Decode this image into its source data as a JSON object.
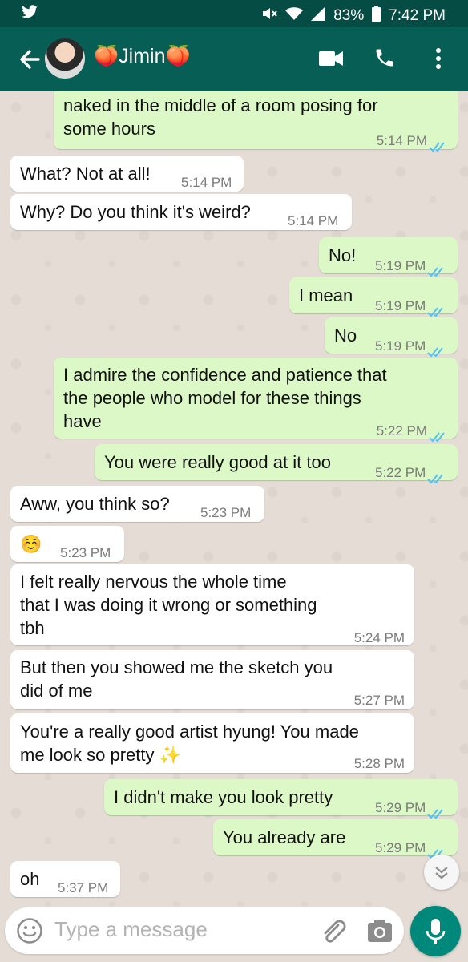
{
  "status_bar": {
    "battery": "83%",
    "time": "7:42 PM"
  },
  "header": {
    "contact_emoji_left": "🍑",
    "contact_name": "Jimin",
    "contact_emoji_right": "🍑"
  },
  "messages": [
    {
      "dir": "out",
      "text": "Some people think it's weird to sit bare naked in the middle of a room posing for some hours",
      "visible_text": "naked in the middle of a room posing for\nsome hours",
      "time": "5:14 PM"
    },
    {
      "dir": "in",
      "text": "What? Not at all!",
      "time": "5:14 PM"
    },
    {
      "dir": "in",
      "text": "Why? Do you think it's weird?",
      "time": "5:14 PM"
    },
    {
      "dir": "out",
      "text": "No!",
      "time": "5:19 PM"
    },
    {
      "dir": "out",
      "text": "I mean",
      "time": "5:19 PM"
    },
    {
      "dir": "out",
      "text": "No",
      "time": "5:19 PM"
    },
    {
      "dir": "out",
      "text": "I admire the confidence and patience that\nthe people who model for these things\nhave",
      "time": "5:22 PM"
    },
    {
      "dir": "out",
      "text": "You were really good at it too",
      "time": "5:22 PM"
    },
    {
      "dir": "in",
      "text": "Aww, you think so?",
      "time": "5:23 PM"
    },
    {
      "dir": "in",
      "text": "☺️",
      "time": "5:23 PM"
    },
    {
      "dir": "in",
      "text": "I felt really nervous the whole time\nthat I was doing it wrong or something\ntbh",
      "time": "5:24 PM"
    },
    {
      "dir": "in",
      "text": "But then you showed me the sketch you\ndid of me",
      "time": "5:27 PM"
    },
    {
      "dir": "in",
      "text": "You're a really good artist hyung! You made\nme look so pretty ✨",
      "time": "5:28 PM"
    },
    {
      "dir": "out",
      "text": "I didn't make you look pretty",
      "time": "5:29 PM"
    },
    {
      "dir": "out",
      "text": "You already are",
      "time": "5:29 PM"
    },
    {
      "dir": "in",
      "text": "oh",
      "time": "5:37 PM"
    }
  ],
  "composer": {
    "placeholder": "Type a message"
  },
  "colors": {
    "header": "#075e54",
    "statusbar": "#054d44",
    "outgoing": "#dcf8c6",
    "incoming": "#ffffff",
    "tick": "#4fc3f7",
    "mic": "#00897b"
  },
  "icons": [
    "twitter-icon",
    "back-arrow-icon",
    "video-call-icon",
    "phone-icon",
    "more-options-icon",
    "emoji-icon",
    "attach-icon",
    "camera-icon",
    "mic-icon",
    "scroll-down-icon"
  ]
}
